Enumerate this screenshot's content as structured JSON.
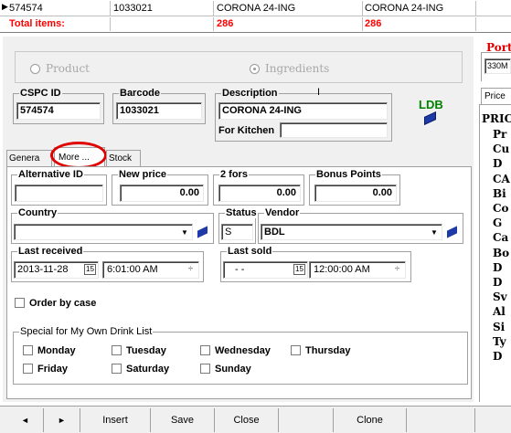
{
  "grid": {
    "row": {
      "id": "574574",
      "barcode": "1033021",
      "desc1": "CORONA 24-ING",
      "desc2": "CORONA 24-ING"
    },
    "total": {
      "label": "Total items:",
      "v1": "286",
      "v2": "286"
    }
  },
  "portion": {
    "label": "Porti",
    "field": "330M"
  },
  "radios": {
    "product": "Product",
    "ingredients": "Ingredients"
  },
  "fields": {
    "cspc_label": "CSPC ID",
    "cspc_value": "574574",
    "barcode_label": "Barcode",
    "barcode_value": "1033021",
    "desc_label": "Description",
    "desc_value": "CORONA 24-ING",
    "kitchen_label": "For Kitchen",
    "kitchen_value": ""
  },
  "ldb": "LDB",
  "tabs": {
    "general": "Genera",
    "more": "More ...",
    "stock": "Stock"
  },
  "more": {
    "alt_id_label": "Alternative ID",
    "alt_id_value": "",
    "new_price_label": "New price",
    "new_price_value": "0.00",
    "twofors_label": "2 fors",
    "twofors_value": "0.00",
    "bonus_label": "Bonus Points",
    "bonus_value": "0.00",
    "country_label": "Country",
    "country_value": "",
    "status_label": "Status",
    "status_value": "S",
    "vendor_label": "Vendor",
    "vendor_value": "BDL",
    "last_received_label": "Last received",
    "last_received_date": "2013-11-28",
    "last_received_time": "6:01:00 AM",
    "last_sold_label": "Last sold",
    "last_sold_date": "- -",
    "last_sold_time": "12:00:00 AM",
    "order_by_case": "Order by case",
    "special_label": "Special for My Own Drink List",
    "days": [
      "Monday",
      "Tuesday",
      "Wednesday",
      "Thursday",
      "Friday",
      "Saturday",
      "Sunday"
    ]
  },
  "price_panel": {
    "tab": "Price",
    "title": "PRIC",
    "rows": [
      "Pr",
      "Cu",
      "D",
      "CA",
      "Bi",
      "Co",
      "G",
      "Ca",
      "Bo",
      "D",
      "D",
      "Sv",
      "Al",
      "Si",
      "Ty",
      "D"
    ]
  },
  "toolbar": {
    "prev": "◄",
    "next": "►",
    "insert": "Insert",
    "save": "Save",
    "close": "Close",
    "clone": "Clone"
  },
  "colors": {
    "total_red": "#ff0000",
    "annotation_red": "#e00000",
    "ldb_green": "#008000"
  }
}
